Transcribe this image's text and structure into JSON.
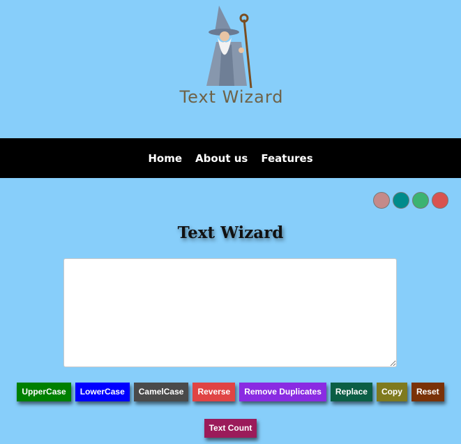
{
  "logo": {
    "text": "Text Wizard",
    "icon": "wizard-icon"
  },
  "nav": {
    "items": [
      {
        "label": "Home"
      },
      {
        "label": "About us"
      },
      {
        "label": "Features"
      }
    ]
  },
  "themes": [
    {
      "color": "#c48a8a"
    },
    {
      "color": "#008b8b"
    },
    {
      "color": "#3cb371"
    },
    {
      "color": "#d9534f"
    }
  ],
  "main": {
    "title": "Text Wizard",
    "textarea": {
      "value": "",
      "placeholder": ""
    }
  },
  "buttons": [
    {
      "label": "UpperCase",
      "color": "#008000"
    },
    {
      "label": "LowerCase",
      "color": "#0000ff"
    },
    {
      "label": "CamelCase",
      "color": "#4a4a4a"
    },
    {
      "label": "Reverse",
      "color": "#e04444"
    },
    {
      "label": "Remove Duplicates",
      "color": "#8a2be2"
    },
    {
      "label": "Replace",
      "color": "#0b5e45"
    },
    {
      "label": "Copy",
      "color": "#7f7a1e"
    },
    {
      "label": "Reset",
      "color": "#7a3208"
    }
  ],
  "button_text_count": {
    "label": "Text Count",
    "color": "#9b1b5a"
  }
}
